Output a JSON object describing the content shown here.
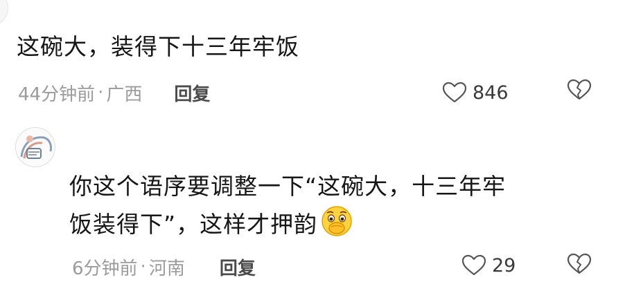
{
  "comments": [
    {
      "text": "这碗大，装得下十三年牢饭",
      "time": "44分钟前",
      "location": "广西",
      "reply_label": "回复",
      "likes": "846"
    },
    {
      "line1": "你这个语序要调整一下“这碗大，十三年牢",
      "line2": "饭装得下”，这样才押韵",
      "time": "6分钟前",
      "location": "河南",
      "reply_label": "回复",
      "likes": "29",
      "emoji": "covering-mouth-emoji"
    }
  ],
  "separator": "·",
  "icons": {
    "like": "heart-outline-icon",
    "dislike": "broken-heart-icon"
  },
  "colors": {
    "text": "#161616",
    "meta": "#9b9b9b",
    "reply": "#4a4a4a",
    "icon": "#555555"
  }
}
